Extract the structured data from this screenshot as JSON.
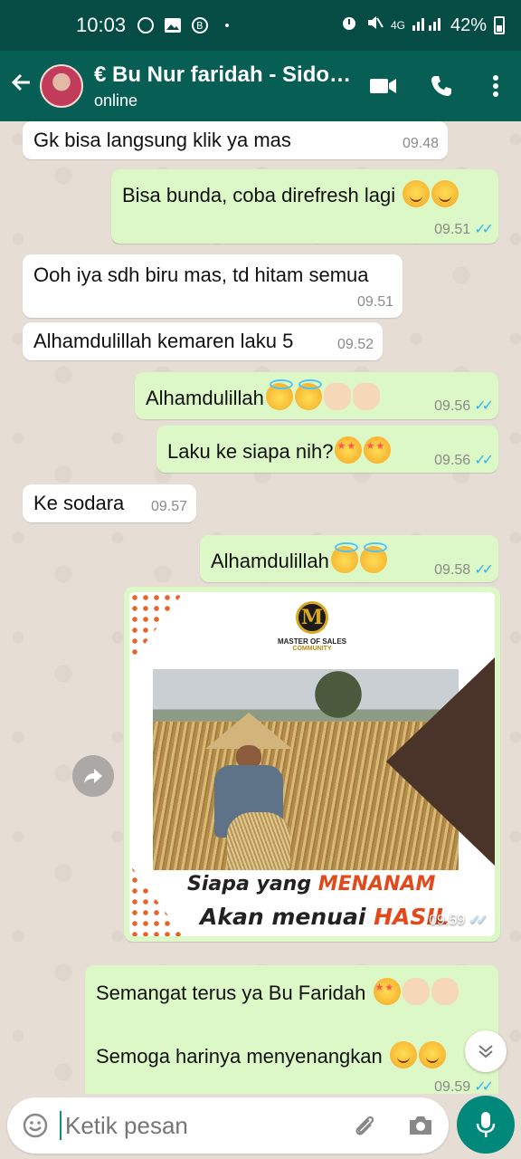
{
  "status_bar": {
    "time": "10:03",
    "battery": "42%",
    "network": "4G"
  },
  "header": {
    "back_icon": "arrow-left-icon",
    "contact_name": "€ Bu Nur faridah - Sidoarjo",
    "status": "online"
  },
  "messages": [
    {
      "dir": "in",
      "text": "Gk bisa langsung klik ya mas",
      "time": "09.48"
    },
    {
      "dir": "out",
      "text": "Bisa bunda, coba direfresh lagi",
      "time": "09.51",
      "emoji": [
        "smile",
        "smile"
      ]
    },
    {
      "dir": "in",
      "text": "Ooh iya sdh biru mas, td hitam semua",
      "time": "09.51"
    },
    {
      "dir": "in",
      "text": "Alhamdulillah kemaren laku 5",
      "time": "09.52"
    },
    {
      "dir": "out",
      "text": "Alhamdulillah",
      "time": "09.56",
      "emoji": [
        "halo",
        "halo",
        "hand",
        "hand"
      ]
    },
    {
      "dir": "out",
      "text": "Laku ke siapa nih?",
      "time": "09.56",
      "emoji": [
        "star",
        "star"
      ]
    },
    {
      "dir": "in",
      "text": "Ke sodara",
      "time": "09.57"
    },
    {
      "dir": "out",
      "text": "Alhamdulillah",
      "time": "09.58",
      "emoji": [
        "halo",
        "halo"
      ]
    }
  ],
  "image_message": {
    "time": "09.59",
    "logo_letter": "M",
    "logo_line1": "MASTER OF SALES",
    "logo_line2": "COMMUNITY",
    "line1_prefix": "Siapa yang ",
    "line1_accent": "MENANAM",
    "line2_prefix": "Akan menuai ",
    "line2_accent": "HASIL"
  },
  "last_message": {
    "line1": "Semangat terus ya Bu Faridah",
    "line2": "Semoga harinya menyenangkan",
    "time": "09.59"
  },
  "input": {
    "placeholder": "Ketik pesan"
  },
  "colors": {
    "header": "#075e54",
    "status_bar": "#054d44",
    "outgoing": "#dcf8c6",
    "incoming": "#ffffff",
    "mic": "#00897b",
    "read_ticks": "#34b7f1"
  }
}
